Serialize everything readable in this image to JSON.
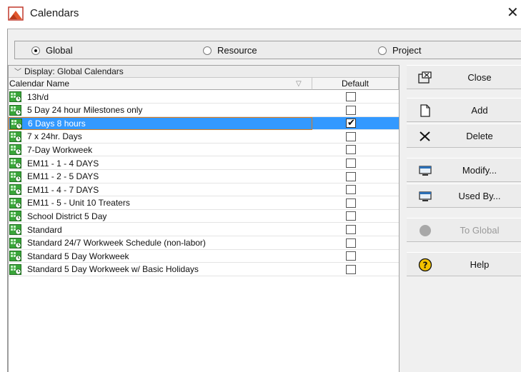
{
  "window": {
    "title": "Calendars",
    "close_glyph": "✕"
  },
  "scope": {
    "options": [
      {
        "label": "Global",
        "selected": true
      },
      {
        "label": "Resource",
        "selected": false
      },
      {
        "label": "Project",
        "selected": false
      }
    ]
  },
  "list": {
    "display_label": "Display: Global Calendars",
    "columns": {
      "name": "Calendar Name",
      "default": "Default"
    },
    "rows": [
      {
        "name": "13h/d",
        "default": false,
        "selected": false
      },
      {
        "name": "5 Day 24 hour Milestones only",
        "default": false,
        "selected": false
      },
      {
        "name": "6 Days 8 hours",
        "default": true,
        "selected": true
      },
      {
        "name": "7 x 24hr. Days",
        "default": false,
        "selected": false
      },
      {
        "name": "7-Day Workweek",
        "default": false,
        "selected": false
      },
      {
        "name": "EM11 - 1 - 4 DAYS",
        "default": false,
        "selected": false
      },
      {
        "name": "EM11 - 2 - 5 DAYS",
        "default": false,
        "selected": false
      },
      {
        "name": "EM11 - 4 - 7 DAYS",
        "default": false,
        "selected": false
      },
      {
        "name": "EM11 - 5 - Unit 10 Treaters",
        "default": false,
        "selected": false
      },
      {
        "name": "School District 5 Day",
        "default": false,
        "selected": false
      },
      {
        "name": "Standard",
        "default": false,
        "selected": false
      },
      {
        "name": "Standard 24/7 Workweek Schedule (non-labor)",
        "default": false,
        "selected": false
      },
      {
        "name": "Standard 5 Day Workweek",
        "default": false,
        "selected": false
      },
      {
        "name": "Standard 5 Day Workweek w/ Basic Holidays",
        "default": false,
        "selected": false
      }
    ]
  },
  "buttons": {
    "close": "Close",
    "add": "Add",
    "delete": "Delete",
    "modify": "Modify...",
    "used_by": "Used By...",
    "to_global": "To Global",
    "help": "Help"
  },
  "colors": {
    "selection": "#3399ff",
    "selection_border": "#d97a1d",
    "help_icon": "#f2c200",
    "calendar_icon": "#3aa63a"
  }
}
